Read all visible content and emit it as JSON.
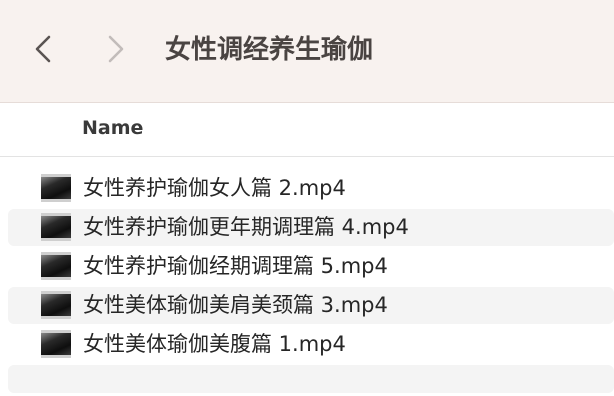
{
  "toolbar": {
    "back_icon": "chevron-left-icon",
    "forward_icon": "chevron-right-icon",
    "folder_title": "女性调经养生瑜伽"
  },
  "list": {
    "column_name_header": "Name",
    "files": [
      {
        "name": "女性养护瑜伽女人篇 2.mp4",
        "icon": "video-thumbnail-icon"
      },
      {
        "name": "女性养护瑜伽更年期调理篇 4.mp4",
        "icon": "video-thumbnail-icon"
      },
      {
        "name": "女性养护瑜伽经期调理篇 5.mp4",
        "icon": "video-thumbnail-icon"
      },
      {
        "name": "女性美体瑜伽美肩美颈篇 3.mp4",
        "icon": "video-thumbnail-icon"
      },
      {
        "name": "女性美体瑜伽美腹篇 1.mp4",
        "icon": "video-thumbnail-icon"
      }
    ]
  },
  "colors": {
    "toolbar_bg": "#f8f2ef",
    "row_stripe": "#f4f4f4",
    "title_text": "#4a4442"
  }
}
